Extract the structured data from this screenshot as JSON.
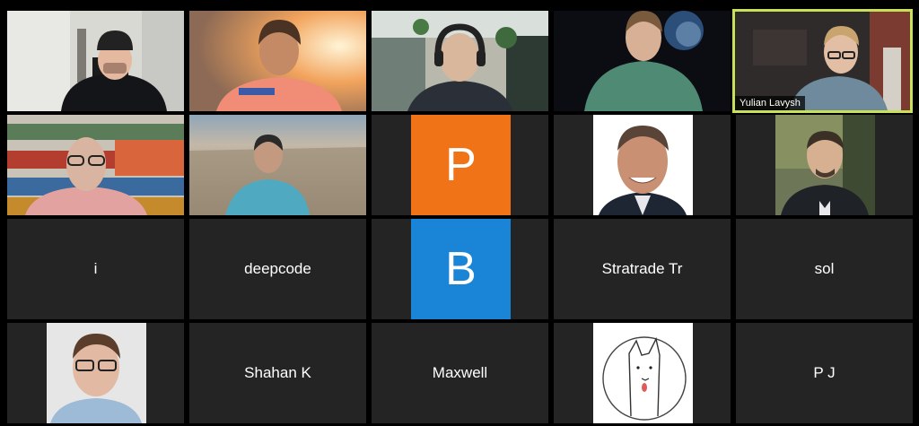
{
  "gallery": {
    "active_speaker": "Yulian Lavysh",
    "rows": [
      [
        {
          "type": "video",
          "icon": "person-video-icon"
        },
        {
          "type": "video",
          "icon": "person-video-icon"
        },
        {
          "type": "video",
          "icon": "person-video-icon"
        },
        {
          "type": "video",
          "icon": "person-video-icon"
        },
        {
          "type": "video",
          "icon": "person-video-icon",
          "name": "Yulian Lavysh"
        }
      ],
      [
        {
          "type": "video",
          "icon": "person-video-icon"
        },
        {
          "type": "video",
          "icon": "person-video-icon"
        },
        {
          "type": "avatar",
          "letter": "P",
          "color": "#f07417"
        },
        {
          "type": "photo",
          "icon": "profile-photo-icon"
        },
        {
          "type": "photo",
          "icon": "profile-photo-icon"
        }
      ],
      [
        {
          "type": "name",
          "name": "i"
        },
        {
          "type": "name",
          "name": "deepcode"
        },
        {
          "type": "avatar",
          "letter": "B",
          "color": "#1a84d6"
        },
        {
          "type": "name",
          "name": "Stratrade Tr"
        },
        {
          "type": "name",
          "name": "sol"
        }
      ],
      [
        {
          "type": "photo",
          "icon": "profile-photo-icon"
        },
        {
          "type": "name",
          "name": "Shahan K"
        },
        {
          "type": "name",
          "name": "Maxwell"
        },
        {
          "type": "photo",
          "icon": "drawing-avatar-icon"
        },
        {
          "type": "name",
          "name": "P J"
        }
      ]
    ]
  },
  "colors": {
    "background": "#000000",
    "tile": "#242424",
    "active_border": "#c9e05a",
    "avatar_orange": "#f07417",
    "avatar_blue": "#1a84d6"
  }
}
